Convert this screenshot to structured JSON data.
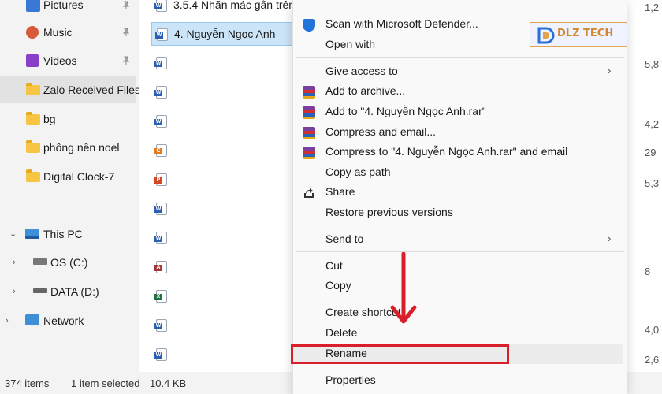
{
  "nav": {
    "quick_access": [
      {
        "label": "Pictures",
        "icon": "pictures-icon",
        "pinned": true
      },
      {
        "label": "Music",
        "icon": "music-icon",
        "pinned": true
      },
      {
        "label": "Videos",
        "icon": "videos-icon",
        "pinned": true
      },
      {
        "label": "Zalo Received Files",
        "icon": "folder-icon",
        "pinned": false,
        "selected": true
      },
      {
        "label": "bg",
        "icon": "folder-icon",
        "pinned": false
      },
      {
        "label": "phông nền noel",
        "icon": "folder-icon",
        "pinned": false
      },
      {
        "label": "Digital Clock-7",
        "icon": "folder-icon",
        "pinned": false
      }
    ],
    "this_pc": {
      "label": "This PC",
      "icon": "computer-icon"
    },
    "drives": [
      {
        "label": "OS (C:)",
        "icon": "drive-icon"
      },
      {
        "label": "DATA (D:)",
        "icon": "drive-icon"
      }
    ],
    "network": {
      "label": "Network",
      "icon": "network-icon"
    }
  },
  "files": {
    "rows": [
      {
        "name": "3.5.4 Nhãn mác gắn trên",
        "type": "word"
      },
      {
        "name": "4. Nguyễn Ngọc Anh",
        "type": "word",
        "selected": true
      },
      {
        "name": "",
        "type": "word"
      },
      {
        "name": "",
        "type": "word"
      },
      {
        "name": "",
        "type": "word"
      },
      {
        "name": "",
        "type": "pdf"
      },
      {
        "name": "",
        "type": "ppt"
      },
      {
        "name": "",
        "type": "word"
      },
      {
        "name": "",
        "type": "word"
      },
      {
        "name": "",
        "type": "access"
      },
      {
        "name": "",
        "type": "excel"
      },
      {
        "name": "",
        "type": "word"
      },
      {
        "name": "",
        "type": "word"
      }
    ],
    "sizes": [
      "1,2",
      "5,8",
      "4,2",
      "29",
      "5,3",
      "8",
      "4,0",
      "2,6"
    ]
  },
  "status": {
    "item_count": "374 items",
    "selection": "1 item selected",
    "size": "10.4 KB"
  },
  "context_menu": {
    "items": [
      {
        "label": "Scan with Microsoft Defender...",
        "icon": "defender-shield-icon"
      },
      {
        "label": "Open with"
      },
      {
        "label": "Give access to",
        "submenu": true
      },
      {
        "label": "Add to archive...",
        "icon": "winrar-icon"
      },
      {
        "label": "Add to \"4. Nguyễn Ngọc Anh.rar\"",
        "icon": "winrar-icon"
      },
      {
        "label": "Compress and email...",
        "icon": "winrar-icon"
      },
      {
        "label": "Compress to \"4. Nguyễn Ngọc Anh.rar\" and email",
        "icon": "winrar-icon"
      },
      {
        "label": "Copy as path"
      },
      {
        "label": "Share",
        "icon": "share-icon"
      },
      {
        "label": "Restore previous versions"
      },
      {
        "label": "Send to",
        "submenu": true
      },
      {
        "label": "Cut"
      },
      {
        "label": "Copy"
      },
      {
        "label": "Create shortcut"
      },
      {
        "label": "Delete"
      },
      {
        "label": "Rename",
        "highlighted": true
      },
      {
        "label": "Properties"
      }
    ],
    "submenu_arrow": "›"
  },
  "logo": {
    "text": "DLZ TECH"
  },
  "colors": {
    "highlight": "#d81f2a",
    "selection": "#cce4f7",
    "folder": "#f5c543",
    "logo_accent": "#d6862a"
  }
}
